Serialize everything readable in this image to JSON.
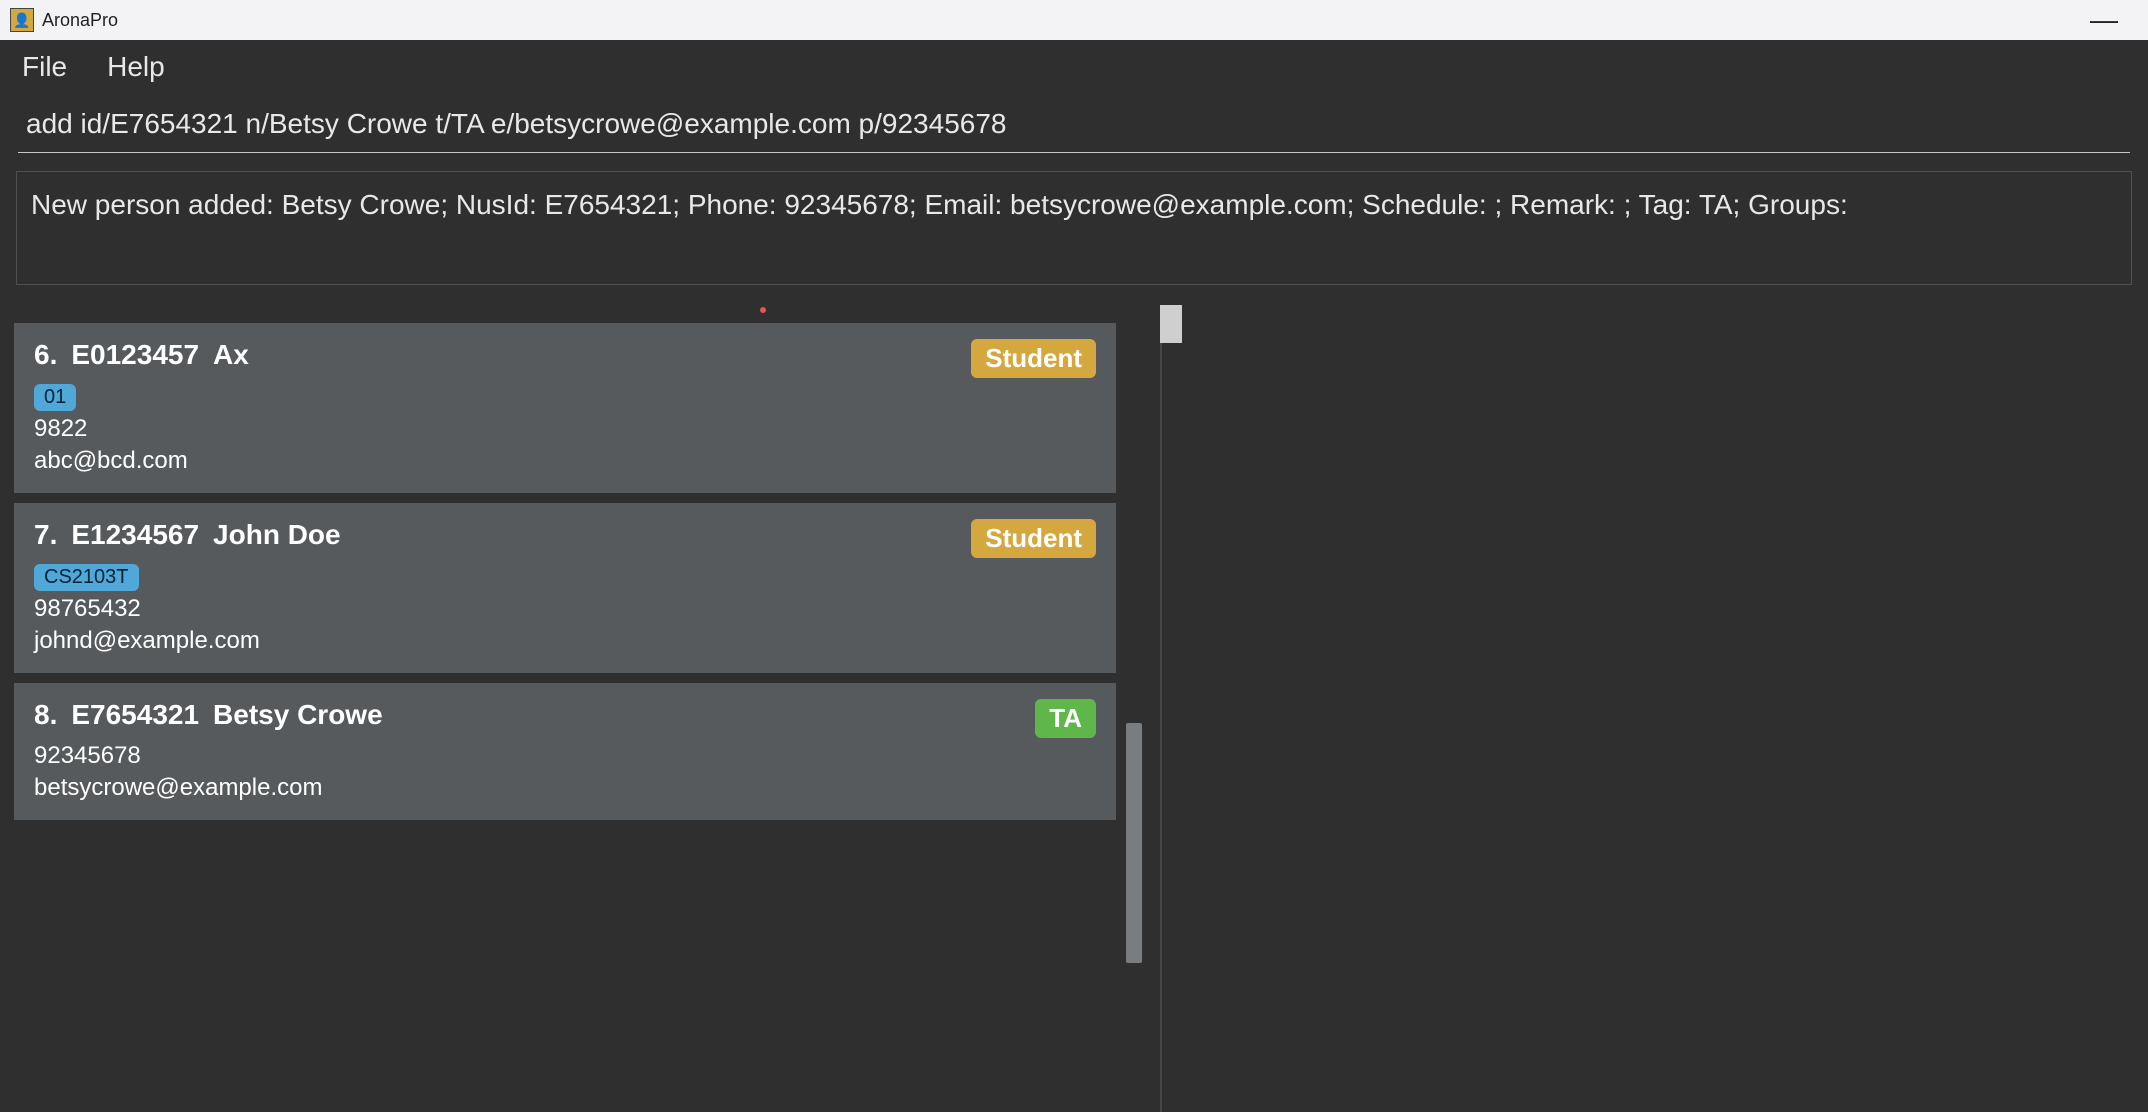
{
  "app": {
    "title": "AronaPro"
  },
  "menu": {
    "file": "File",
    "help": "Help"
  },
  "command_input": {
    "value": "add id/E7654321 n/Betsy Crowe t/TA e/betsycrowe@example.com p/92345678"
  },
  "result": {
    "text": "New person added: Betsy Crowe; NusId: E7654321; Phone: 92345678; Email: betsycrowe@example.com; Schedule: ; Remark: ; Tag: TA; Groups:"
  },
  "persons": [
    {
      "index": "6.",
      "nusid": "E0123457",
      "name": "Ax",
      "tag": "Student",
      "tag_class": "tag-student",
      "group": "01",
      "phone": "9822",
      "email": "abc@bcd.com"
    },
    {
      "index": "7.",
      "nusid": "E1234567",
      "name": "John Doe",
      "tag": "Student",
      "tag_class": "tag-student",
      "group": "CS2103T",
      "phone": "98765432",
      "email": "johnd@example.com"
    },
    {
      "index": "8.",
      "nusid": "E7654321",
      "name": "Betsy Crowe",
      "tag": "TA",
      "tag_class": "tag-ta",
      "group": "",
      "phone": "92345678",
      "email": "betsycrowe@example.com"
    }
  ]
}
